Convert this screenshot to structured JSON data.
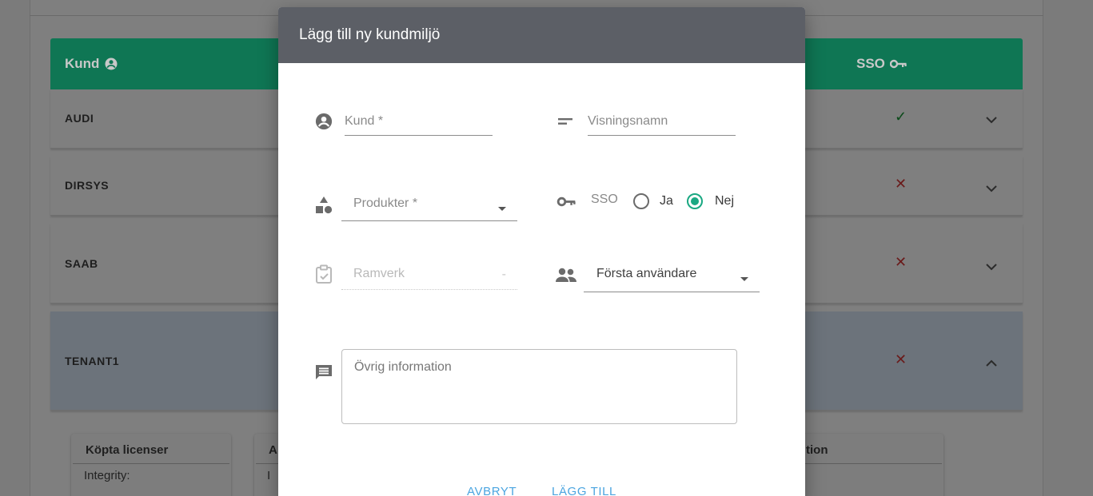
{
  "background": {
    "table": {
      "header": {
        "kund_label": "Kund",
        "sso_label": "SSO"
      },
      "rows": [
        {
          "name": "AUDI",
          "sso": "✓"
        },
        {
          "name": "DIRSYS",
          "sso": "✕"
        },
        {
          "name": "SAAB",
          "sso": "✕"
        },
        {
          "name": "TENANT1",
          "sso": "✕"
        }
      ],
      "expanded": {
        "card1_title": "Köpta licenser",
        "card1_line": "Integrity:",
        "card2_title": "A",
        "card2_line": "I",
        "card3_title": "tion"
      }
    }
  },
  "dialog": {
    "title": "Lägg till ny kundmiljö",
    "kund_placeholder": "Kund *",
    "visningsnamn_placeholder": "Visningsnamn",
    "produkter_label": "Produkter *",
    "sso_label": "SSO",
    "sso_options": {
      "ja": "Ja",
      "nej": "Nej",
      "selected": "Nej"
    },
    "ramverk_label": "Ramverk",
    "ramverk_dash": "-",
    "forsta_anvandare_label": "Första användare",
    "ovrig_information_placeholder": "Övrig information",
    "buttons": {
      "cancel": "AVBRYT",
      "add": "LÄGG TILL"
    },
    "accent_color": "#1aa882",
    "button_color": "#4ba5e0"
  }
}
